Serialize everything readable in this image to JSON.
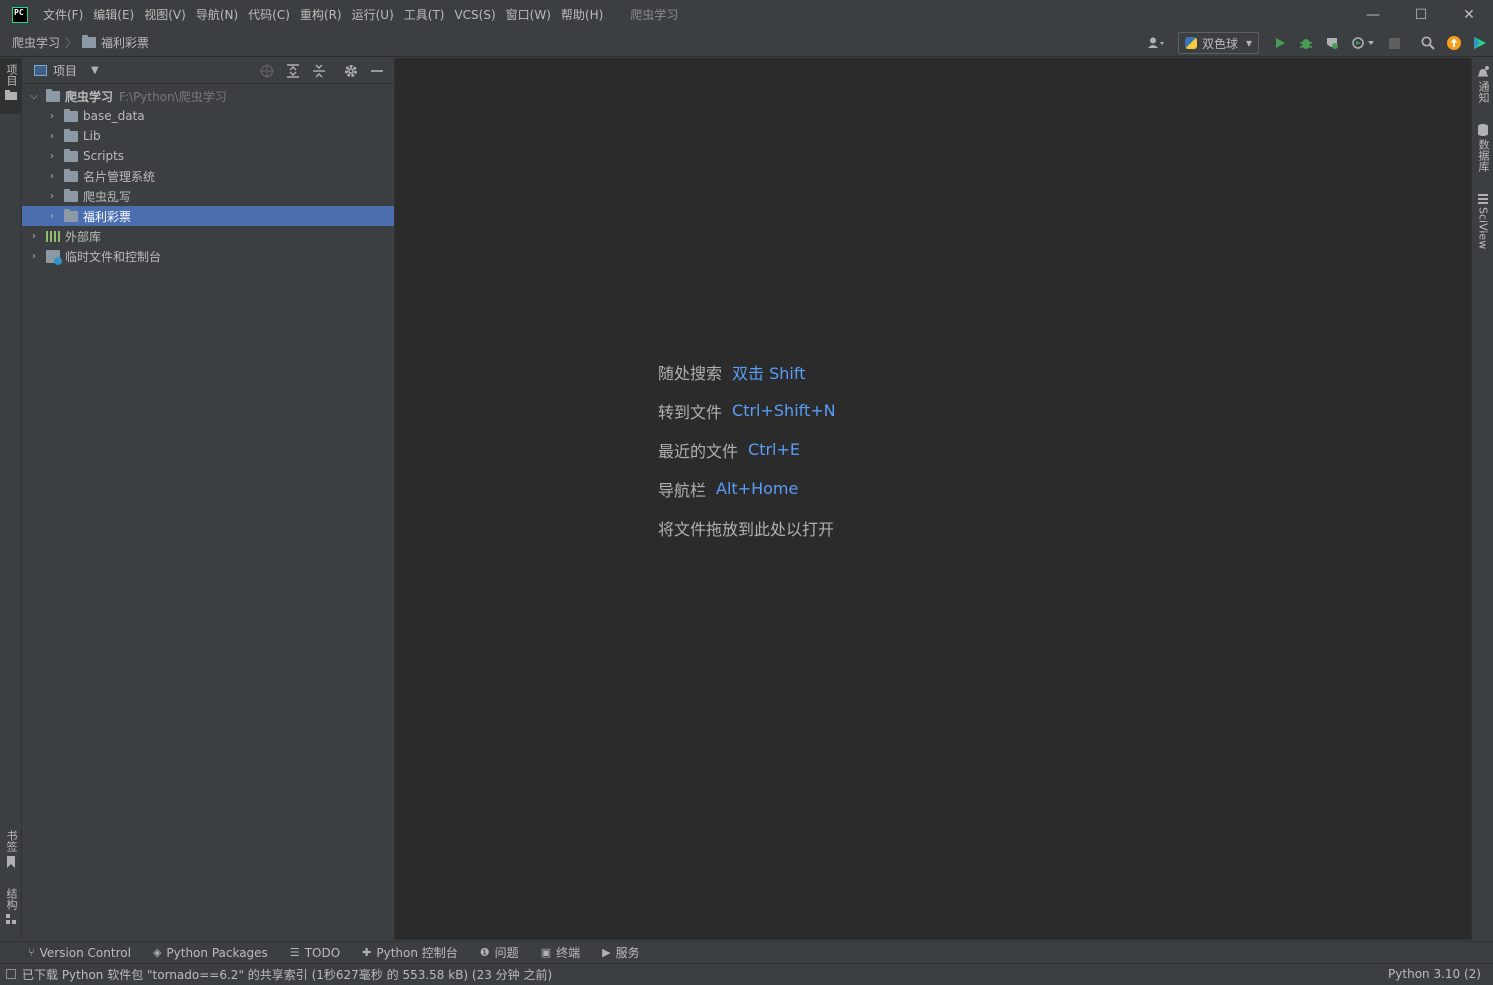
{
  "app": {
    "logo_text": "PC",
    "window_title": "爬虫学习"
  },
  "menu": [
    "文件(F)",
    "编辑(E)",
    "视图(V)",
    "导航(N)",
    "代码(C)",
    "重构(R)",
    "运行(U)",
    "工具(T)",
    "VCS(S)",
    "窗口(W)",
    "帮助(H)"
  ],
  "window_controls": {
    "minimize": "—",
    "maximize": "☐",
    "close": "✕"
  },
  "breadcrumb": {
    "root": "爬虫学习",
    "sep": "〉",
    "current": "福利彩票"
  },
  "toolbar": {
    "run_config": "双色球",
    "dropdown": "▾"
  },
  "left_strip": {
    "project_tab": "项目",
    "bookmarks_tab": "书签",
    "structure_tab": "结构"
  },
  "right_strip": {
    "notifications_tab": "通知",
    "database_tab": "数据库",
    "sciview_tab": "SciView"
  },
  "project_panel": {
    "title": "项目",
    "root": {
      "name": "爬虫学习",
      "path": "F:\\Python\\爬虫学习"
    },
    "children": [
      "base_data",
      "Lib",
      "Scripts",
      "名片管理系统",
      "爬虫乱写",
      "福利彩票"
    ],
    "external_libs": "外部库",
    "scratches": "临时文件和控制台"
  },
  "editor_hints": [
    {
      "label": "随处搜索",
      "key": "双击 Shift"
    },
    {
      "label": "转到文件",
      "key": "Ctrl+Shift+N"
    },
    {
      "label": "最近的文件",
      "key": "Ctrl+E"
    },
    {
      "label": "导航栏",
      "key": "Alt+Home"
    },
    {
      "label": "将文件拖放到此处以打开",
      "key": ""
    }
  ],
  "bottom_tabs": [
    "Version Control",
    "Python Packages",
    "TODO",
    "Python 控制台",
    "问题",
    "终端",
    "服务"
  ],
  "status": {
    "message": "已下载 Python 软件包 \"tornado==6.2\" 的共享索引 (1秒627毫秒 的 553.58 kB) (23 分钟 之前)",
    "interpreter": "Python 3.10 (2)"
  }
}
